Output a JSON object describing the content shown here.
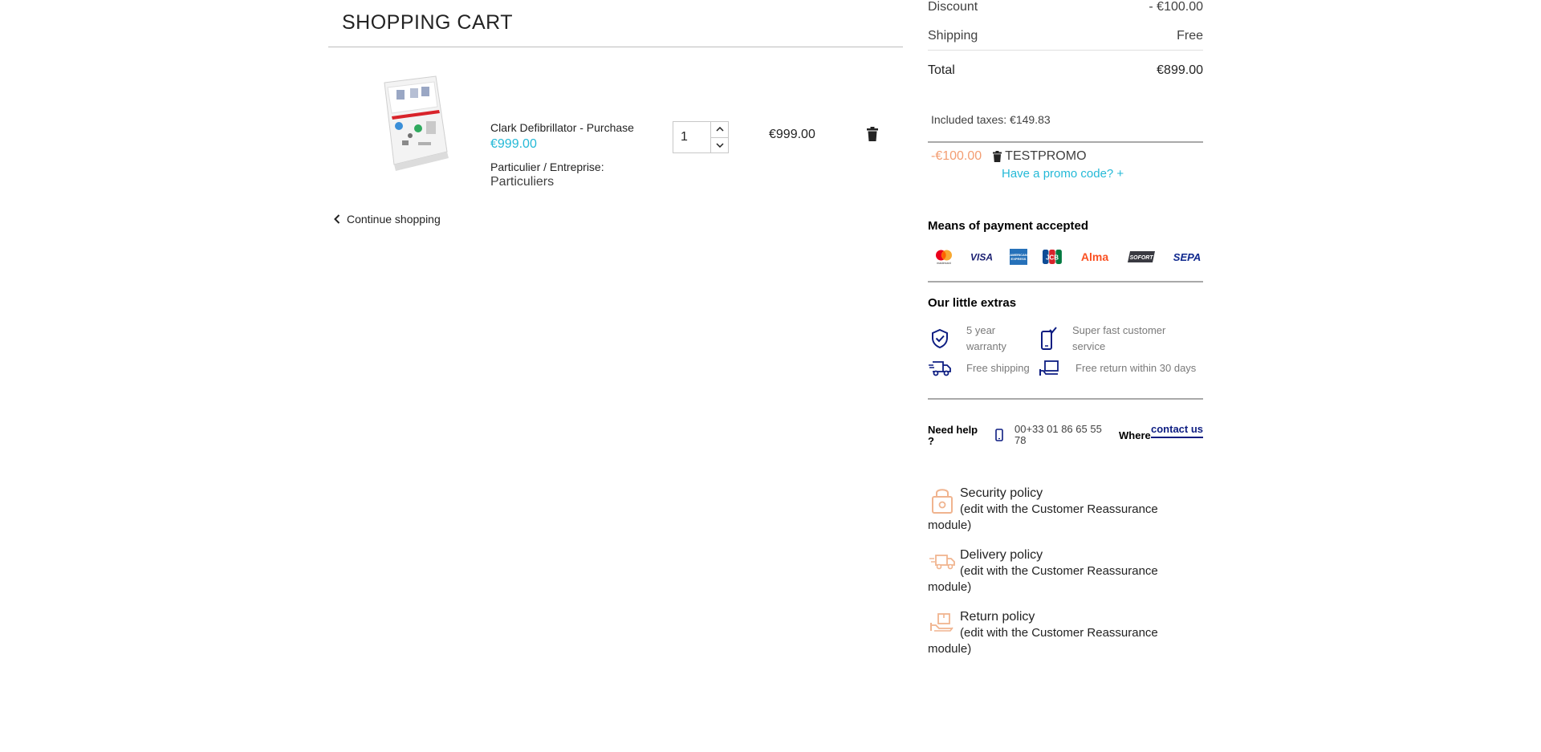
{
  "cart": {
    "title": "SHOPPING CART",
    "item": {
      "name": "Clark Defibrillator - Purchase",
      "unit_price": "€999.00",
      "attribute_label": "Particulier / Entreprise:",
      "attribute_value": "Particuliers",
      "quantity": "1",
      "line_total": "€999.00"
    },
    "continue_label": "Continue shopping"
  },
  "summary": {
    "discount_label": "Discount",
    "discount_value": "- €100.00",
    "shipping_label": "Shipping",
    "shipping_value": "Free",
    "total_label": "Total",
    "total_value": "€899.00",
    "taxes": "Included taxes: €149.83",
    "promo_amount": "-€100.00",
    "promo_code": "TESTPROMO",
    "promo_toggle": "Have a promo code? +"
  },
  "payment": {
    "title": "Means of payment accepted",
    "methods": [
      "mastercard",
      "VISA",
      "AMERICAN EXPRESS",
      "JCB",
      "Alma",
      "SOFORT",
      "SEPA"
    ]
  },
  "extras": {
    "title": "Our little extras",
    "items": [
      {
        "label": "5 year warranty",
        "icon": "shield-check-icon"
      },
      {
        "label": "Super fast customer service",
        "icon": "phone-check-icon"
      },
      {
        "label": "Free shipping",
        "icon": "delivery-truck-icon"
      },
      {
        "label": "Free return within 30 days",
        "icon": "return-laptop-icon"
      }
    ]
  },
  "help": {
    "label": "Need help ?",
    "phone": "00+33 01 86 65 55 78",
    "where": "Where",
    "contact": "contact us"
  },
  "policies": [
    {
      "title": "Security policy",
      "desc": "(edit with the Customer Reassurance module)",
      "icon": "padlock-icon"
    },
    {
      "title": "Delivery policy",
      "desc": "(edit with the Customer Reassurance module)",
      "icon": "truck-icon"
    },
    {
      "title": "Return policy",
      "desc": "(edit with the Customer Reassurance module)",
      "icon": "box-return-icon"
    }
  ],
  "colors": {
    "accent": "#24b9d7",
    "promo": "#f39d72",
    "brand_navy": "#0d1d82",
    "policy_icon": "#f0b48f"
  }
}
